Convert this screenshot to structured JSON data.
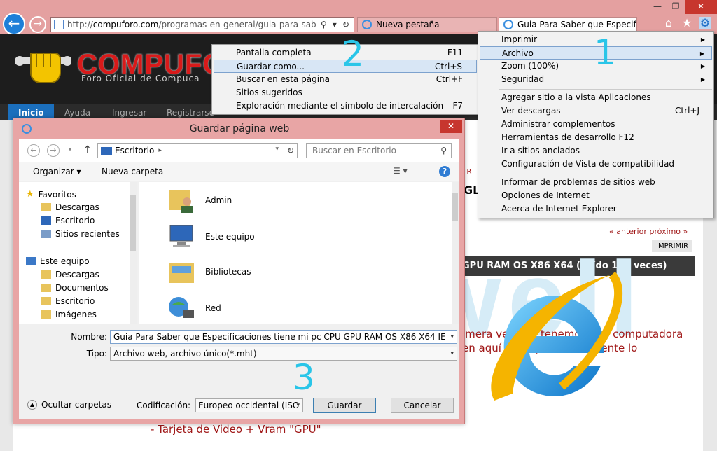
{
  "browser": {
    "address": {
      "url_prefix": "http://",
      "url_host": "compuforo.com",
      "url_rest": "/programas-en-general/guia-para-saber-qu"
    },
    "tabs": [
      {
        "label": "Nueva pestaña"
      },
      {
        "label": "Guia Para Saber que Especif..."
      }
    ],
    "window_controls": {
      "minimize": "—",
      "restore": "❐",
      "close": "✕"
    }
  },
  "site": {
    "logo_text": "COMPUFO",
    "logo_sub": "Foro Oficial de Compuca",
    "nav": [
      "Inicio",
      "Ayuda",
      "Ingresar",
      "Registrarse"
    ],
    "prev_next": "« anterior próximo »",
    "print": "IMPRIMIR",
    "topic_title": "GPU RAM OS X86 X64  (Leído 165 veces)",
    "fragment_ur": "U R",
    "fragment_gl": "GL",
    "body_line_1": "imera vez que tenemos una computadora",
    "body_line_2": "en aquí les dejo como ...mente lo",
    "body_line_3": "- Tarjeta de Video + Vram \"GPU\"",
    "watermark": "Briwell"
  },
  "context_menu": {
    "items": [
      {
        "label": "Pantalla completa",
        "shortcut": "F11"
      },
      {
        "label": "Guardar como...",
        "shortcut": "Ctrl+S"
      },
      {
        "label": "Buscar en esta página",
        "shortcut": "Ctrl+F"
      },
      {
        "label": "Sitios sugeridos",
        "shortcut": ""
      },
      {
        "label": "Exploración mediante el símbolo de intercalación",
        "shortcut": "F7"
      }
    ]
  },
  "tools_menu": {
    "items": [
      {
        "label": "Imprimir",
        "shortcut": ""
      },
      {
        "label": "Archivo",
        "shortcut": ""
      },
      {
        "label": "Zoom (100%)",
        "shortcut": ""
      },
      {
        "label": "Seguridad",
        "shortcut": ""
      },
      {
        "label": "Agregar sitio a la vista Aplicaciones",
        "shortcut": ""
      },
      {
        "label": "Ver descargas",
        "shortcut": "Ctrl+J"
      },
      {
        "label": "Administrar complementos",
        "shortcut": ""
      },
      {
        "label": "Herramientas de desarrollo F12",
        "shortcut": ""
      },
      {
        "label": "Ir a sitios anclados",
        "shortcut": ""
      },
      {
        "label": "Configuración de Vista de compatibilidad",
        "shortcut": ""
      },
      {
        "label": "Informar de problemas de sitios web",
        "shortcut": ""
      },
      {
        "label": "Opciones de Internet",
        "shortcut": ""
      },
      {
        "label": "Acerca de Internet Explorer",
        "shortcut": ""
      }
    ]
  },
  "dialog": {
    "title": "Guardar página web",
    "path": "Escritorio",
    "search_placeholder": "Buscar en Escritorio",
    "organizar": "Organizar",
    "nueva_carpeta": "Nueva carpeta",
    "tree": {
      "favoritos": "Favoritos",
      "fav_items": [
        "Descargas",
        "Escritorio",
        "Sitios recientes"
      ],
      "este_equipo": "Este equipo",
      "pc_items": [
        "Descargas",
        "Documentos",
        "Escritorio",
        "Imágenes"
      ]
    },
    "files": [
      "Admin",
      "Este equipo",
      "Bibliotecas",
      "Red"
    ],
    "nombre_label": "Nombre:",
    "nombre_value": "Guia Para Saber que Especificaciones tiene mi pc CPU GPU RAM OS X86 X64 IE",
    "tipo_label": "Tipo:",
    "tipo_value": "Archivo web, archivo único(*.mht)",
    "ocultar": "Ocultar carpetas",
    "codificacion_label": "Codificación:",
    "codificacion_value": "Europeo occidental (ISO",
    "guardar": "Guardar",
    "cancelar": "Cancelar"
  },
  "annotations": [
    "1",
    "2",
    "3"
  ],
  "colors": {
    "accent": "#29c5e8",
    "chrome": "#e4a0a0",
    "menu_highlight": "#d8e6f5"
  }
}
